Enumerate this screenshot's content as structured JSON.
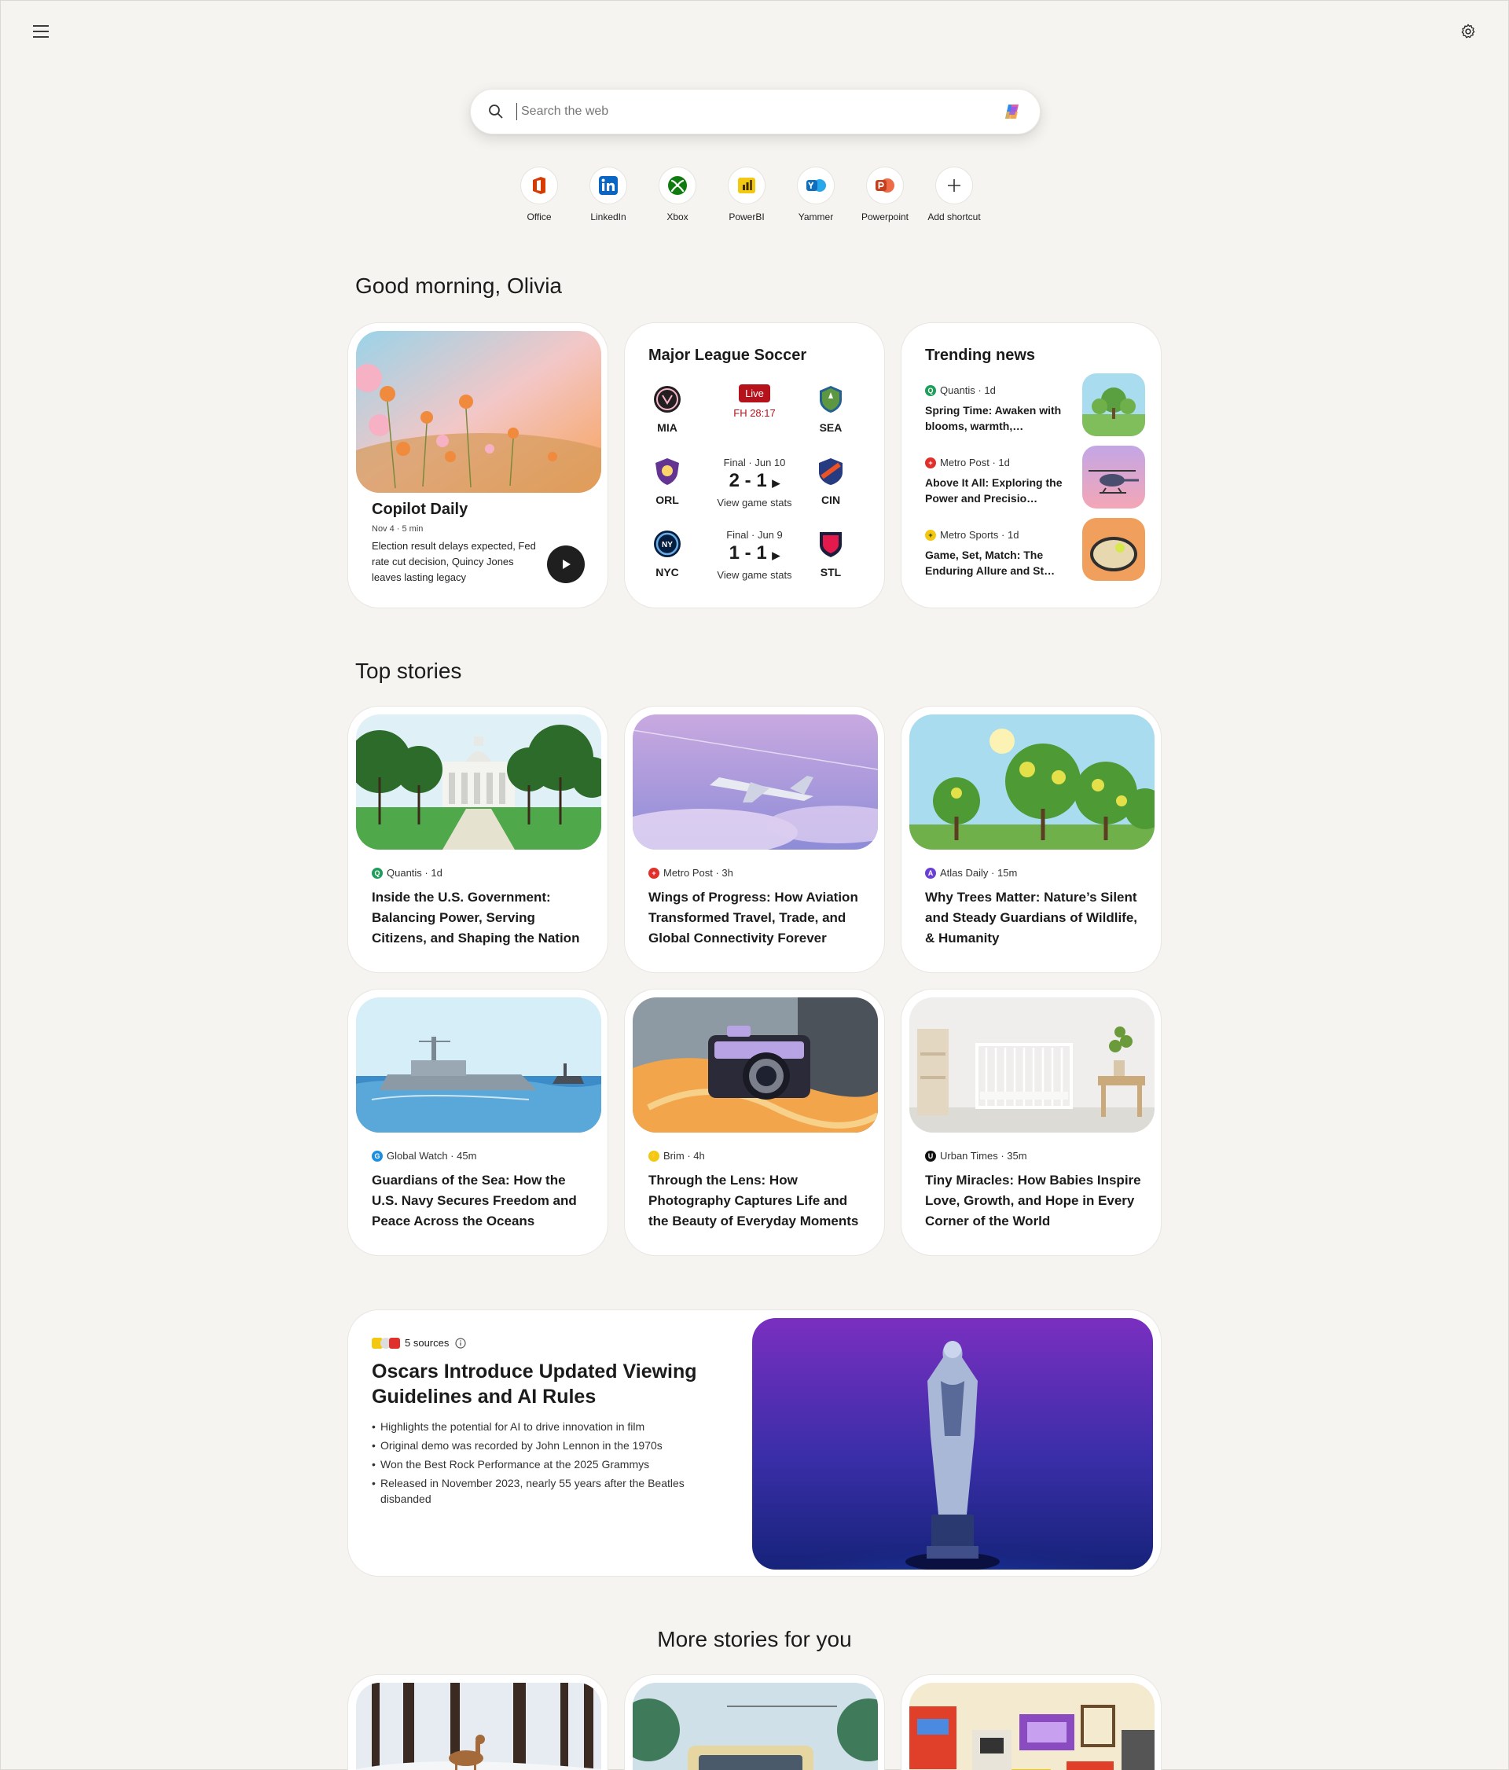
{
  "header": {
    "menu_icon": "hamburger-icon",
    "settings_icon": "gear-icon"
  },
  "search": {
    "placeholder": "Search the web",
    "copilot_icon": "copilot-icon"
  },
  "shortcuts": [
    {
      "label": "Office",
      "icon": "office-icon",
      "color": "#d83b01"
    },
    {
      "label": "LinkedIn",
      "icon": "linkedin-icon",
      "color": "#0a66c2"
    },
    {
      "label": "Xbox",
      "icon": "xbox-icon",
      "color": "#107c10"
    },
    {
      "label": "PowerBI",
      "icon": "powerbi-icon",
      "color": "#f2c811"
    },
    {
      "label": "Yammer",
      "icon": "yammer-icon",
      "color": "#106ebe"
    },
    {
      "label": "Powerpoint",
      "icon": "powerpoint-icon",
      "color": "#c43e1c"
    },
    {
      "label": "Add shortcut",
      "icon": "plus-icon"
    }
  ],
  "greeting": "Good morning, Olivia",
  "copilot_daily": {
    "title": "Copilot Daily",
    "meta": "Nov 4 · 5 min",
    "text": "Election result delays expected, Fed rate cut decision, Quincy Jones leaves lasting legacy"
  },
  "soccer": {
    "title": "Major League Soccer",
    "matches": [
      {
        "home": "MIA",
        "away": "SEA",
        "badge": "Live",
        "time": "FH 28:17"
      },
      {
        "home": "ORL",
        "away": "CIN",
        "status": "Final · Jun 10",
        "score": "2 - 1",
        "link": "View game stats"
      },
      {
        "home": "NYC",
        "away": "STL",
        "status": "Final · Jun 9",
        "score": "1 - 1",
        "link": "View game stats"
      }
    ]
  },
  "trending": {
    "title": "Trending news",
    "items": [
      {
        "source": "Quantis",
        "age": "1d",
        "title": "Spring Time: Awaken with blooms, warmth,…",
        "color": "#1e9e5a"
      },
      {
        "source": "Metro Post",
        "age": "1d",
        "title": "Above It All: Exploring the Power and Precisio…",
        "color": "#e0302b"
      },
      {
        "source": "Metro Sports",
        "age": "1d",
        "title": "Game, Set, Match: The Enduring Allure and St…",
        "color": "#f2c811"
      }
    ]
  },
  "top_stories": {
    "title": "Top stories",
    "items": [
      {
        "source": "Quantis",
        "age": "1d",
        "title": "Inside the U.S. Government: Balancing Power, Serving Citizens, and Shaping the Nation",
        "color": "#1e9e5a"
      },
      {
        "source": "Metro Post",
        "age": "3h",
        "title": "Wings of Progress: How Aviation Transformed Travel, Trade, and Global Connectivity Forever",
        "color": "#e0302b"
      },
      {
        "source": "Atlas Daily",
        "age": "15m",
        "title": "Why Trees Matter: Nature’s Silent and Steady Guardians of Wildlife, & Humanity",
        "color": "#6b3fd6"
      },
      {
        "source": "Global Watch",
        "age": "45m",
        "title": "Guardians of the Sea: How the U.S. Navy Secures Freedom and Peace Across the Oceans",
        "color": "#1d8fe1"
      },
      {
        "source": "Brim",
        "age": "4h",
        "title": "Through the Lens: How Photography Captures Life and the Beauty of Everyday Moments",
        "color": "#f2c811"
      },
      {
        "source": "Urban Times",
        "age": "35m",
        "title": "Tiny Miracles: How Babies Inspire Love, Growth, and Hope in Every Corner of the World",
        "color": "#111111"
      }
    ]
  },
  "feature": {
    "sources": "5 sources",
    "title": "Oscars Introduce Updated Viewing Guidelines and AI Rules",
    "bullets": [
      "Highlights the potential for AI to drive innovation in film",
      "Original demo was recorded by John Lennon in the 1970s",
      "Won the Best Rock Performance at the 2025 Grammys",
      "Released in November 2023, nearly 55 years after the Beatles disbanded"
    ]
  },
  "more_stories": {
    "title": "More stories for you"
  }
}
